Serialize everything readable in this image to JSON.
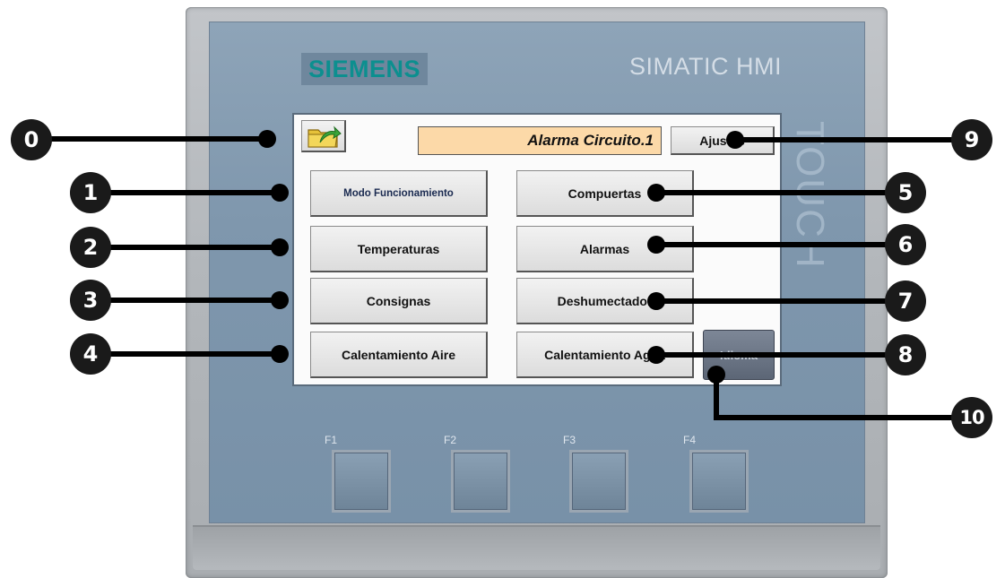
{
  "device": {
    "brand": "SIEMENS",
    "model": "SIMATIC HMI",
    "side_text": "TOUCH"
  },
  "screen": {
    "folder_icon": "folder-arrow-icon",
    "alarm_text": "Alarma Circuito.1",
    "settings_label": "Ajustes",
    "left_buttons": [
      "Modo Funcionamiento",
      "Temperaturas",
      "Consignas",
      "Calentamiento Aire"
    ],
    "right_buttons": [
      "Compuertas",
      "Alarmas",
      "Deshumectador",
      "Calentamiento Agua"
    ],
    "language_label": "Idioma"
  },
  "function_keys": [
    "F1",
    "F2",
    "F3",
    "F4"
  ],
  "callouts": [
    "0",
    "1",
    "2",
    "3",
    "4",
    "5",
    "6",
    "7",
    "8",
    "9",
    "10"
  ],
  "colors": {
    "alarm_background": "#fcd9a8",
    "brand_text": "#0c8f8f",
    "panel_blue": "#7f97ad"
  }
}
